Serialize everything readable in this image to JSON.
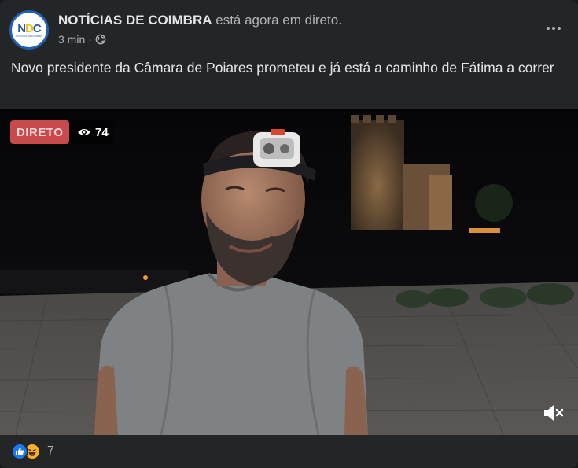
{
  "post": {
    "page_name": "NOTÍCIAS DE COIMBRA",
    "live_suffix": "está agora em direto.",
    "time": "3 min",
    "separator": "·",
    "privacy_icon": "globe-icon",
    "avatar": {
      "logo_text": "NDC",
      "logo_tagline": "NOTÍCIAS DE COIMBRA"
    },
    "text": "Novo presidente da Câmara de Poiares prometeu e já está a caminho de Fátima a correr",
    "more_icon": "more-options-icon"
  },
  "video": {
    "live_badge": "DIRETO",
    "viewer_count": "74",
    "viewer_icon": "eye-icon",
    "mute_icon": "volume-muted-icon"
  },
  "footer": {
    "reaction_icons": [
      "like-icon",
      "haha-icon"
    ],
    "reaction_count": "7"
  },
  "colors": {
    "background": "#242526",
    "primary_text": "#e4e6eb",
    "secondary_text": "#b0b3b8",
    "live_red": "#c84a4d",
    "like_blue": "#1877f2",
    "avatar_border": "#1f5fb3"
  }
}
